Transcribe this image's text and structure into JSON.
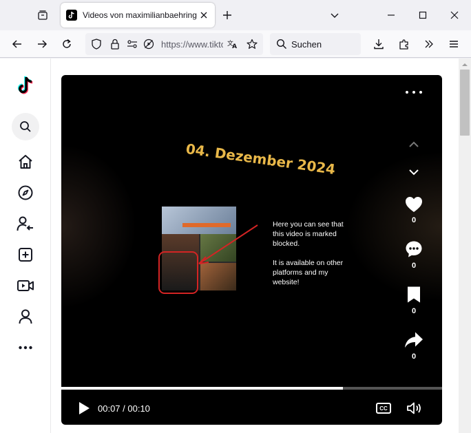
{
  "browser": {
    "tab_title": "Videos von maximilianbaehring",
    "url_text": "https://www.tiktok.com",
    "search_placeholder": "Suchen"
  },
  "video": {
    "overlay_date": "04. Dezember 2024",
    "note_line1": "Here you can see that this video is marked blocked.",
    "note_line2": "It is available on other platforms and my website!",
    "likes": "0",
    "comments": "0",
    "saves": "0",
    "shares": "0",
    "time": "00:07 / 00:10",
    "cc_label": "CC",
    "progress_fraction": 0.74
  },
  "colors": {
    "accent_text": "#e9b849",
    "highlight": "#d42424"
  }
}
